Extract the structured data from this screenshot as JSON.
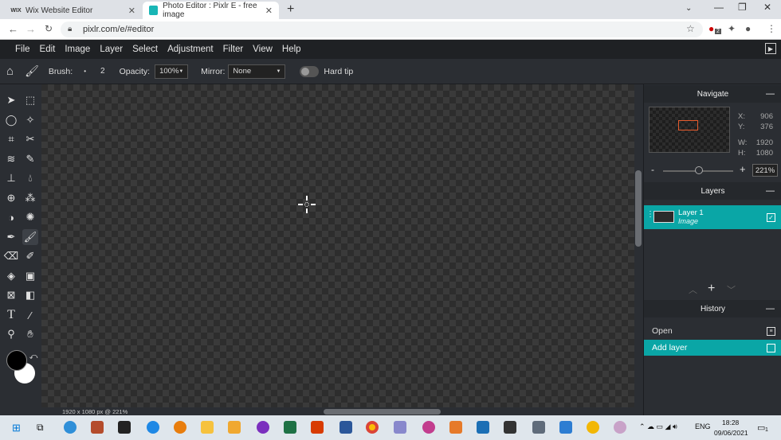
{
  "browser": {
    "tabs": [
      {
        "icon": "WIX",
        "title": "Wix Website Editor"
      },
      {
        "icon": "",
        "title": "Photo Editor : Pixlr E - free image"
      }
    ],
    "url": "pixlr.com/e/#editor",
    "ext_badge": "2"
  },
  "menu": [
    "File",
    "Edit",
    "Image",
    "Layer",
    "Select",
    "Adjustment",
    "Filter",
    "View",
    "Help"
  ],
  "tool_options": {
    "brush_label": "Brush:",
    "brush_size": "2",
    "opacity_label": "Opacity:",
    "opacity_value": "100%",
    "mirror_label": "Mirror:",
    "mirror_value": "None",
    "hardtip_label": "Hard tip"
  },
  "navigate": {
    "title": "Navigate",
    "x_label": "X:",
    "x": "906",
    "y_label": "Y:",
    "y": "376",
    "w_label": "W:",
    "w": "1920",
    "h_label": "H:",
    "h": "1080",
    "zoom": "221%"
  },
  "layers": {
    "title": "Layers",
    "items": [
      {
        "name": "Layer 1",
        "type": "Image"
      }
    ]
  },
  "history": {
    "title": "History",
    "items": [
      "Open",
      "Add layer"
    ]
  },
  "status": "1920 x 1080 px @ 221%",
  "taskbar": {
    "lang": "ENG",
    "time": "18:28",
    "date": "09/06/2021",
    "notif": "1"
  },
  "colors": {
    "accent": "#0aa6a6",
    "fg_swatch": "#000000",
    "bg_swatch": "#ffffff"
  }
}
